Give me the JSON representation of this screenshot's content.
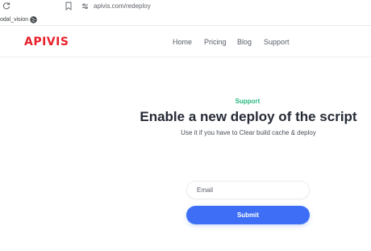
{
  "browser": {
    "url": "apivis.com/redeploy",
    "bookmark_label": "odal_vision",
    "icons": [
      "reload-icon",
      "bookmark-star-icon",
      "site-settings-icon",
      "globe-icon"
    ]
  },
  "header": {
    "logo_text": "APIVIS",
    "nav": {
      "home": "Home",
      "pricing": "Pricing",
      "blog": "Blog",
      "support": "Support"
    }
  },
  "hero": {
    "eyebrow": "Support",
    "title": "Enable a new deploy of the script",
    "subtitle": "Use it if you have to Clear build cache & deploy"
  },
  "form": {
    "email_placeholder": "Email",
    "email_value": "",
    "submit_label": "Submit"
  },
  "colors": {
    "brand": "#e8202a",
    "accent_green": "#25b77e",
    "button_blue": "#3d6ef5",
    "heading": "#262b36"
  }
}
